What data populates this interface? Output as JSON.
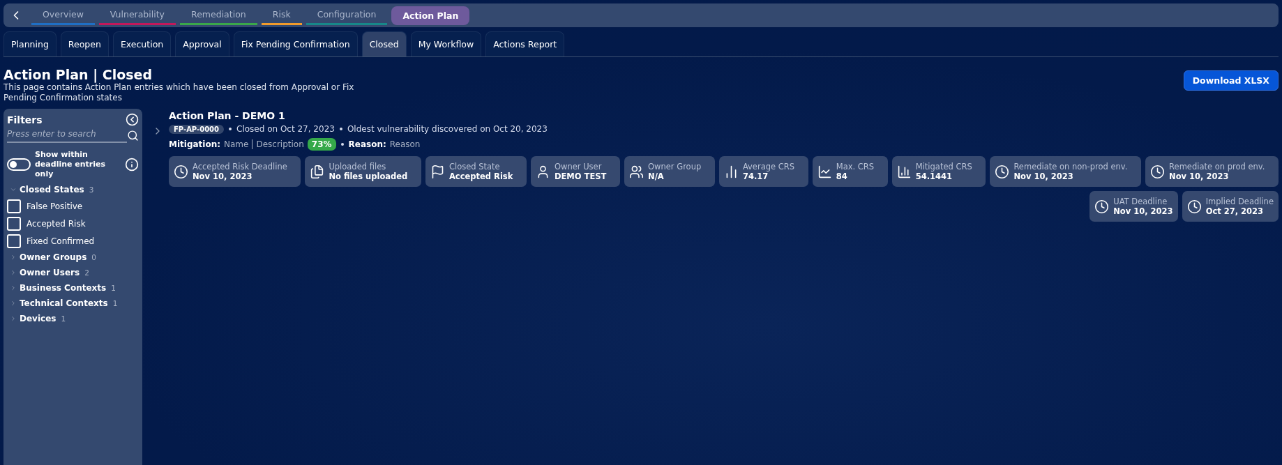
{
  "nav": {
    "tabs": [
      {
        "label": "Overview",
        "selected": false,
        "color": "#1f6fc5"
      },
      {
        "label": "Vulnerability",
        "selected": false,
        "color": "#c2185b"
      },
      {
        "label": "Remediation",
        "selected": false,
        "color": "#3aa84a"
      },
      {
        "label": "Risk",
        "selected": false,
        "color": "#f29b2b"
      },
      {
        "label": "Configuration",
        "selected": false,
        "color": "#17888a"
      },
      {
        "label": "Action Plan",
        "selected": true,
        "color": "#6e5a9c"
      }
    ]
  },
  "subtabs": [
    {
      "label": "Planning",
      "selected": false
    },
    {
      "label": "Reopen",
      "selected": false
    },
    {
      "label": "Execution",
      "selected": false
    },
    {
      "label": "Approval",
      "selected": false
    },
    {
      "label": "Fix Pending Confirmation",
      "selected": false
    },
    {
      "label": "Closed",
      "selected": true
    },
    {
      "label": "My Workflow",
      "selected": false
    },
    {
      "label": "Actions Report",
      "selected": false
    }
  ],
  "header": {
    "title": "Action Plan | Closed",
    "description": "This page contains Action Plan entries which have been closed from Approval or Fix Pending Confirmation states",
    "download_button": "Download XLSX"
  },
  "filters": {
    "title": "Filters",
    "search": {
      "placeholder": "Press enter to search"
    },
    "toggle": {
      "label": "Show within deadline entries only",
      "on": false
    },
    "groups": [
      {
        "label": "Closed States",
        "count": "3",
        "expanded": true,
        "options": [
          {
            "label": "False Positive",
            "checked": false
          },
          {
            "label": "Accepted Risk",
            "checked": false
          },
          {
            "label": "Fixed Confirmed",
            "checked": false
          }
        ]
      },
      {
        "label": "Owner Groups",
        "count": "0",
        "expanded": false
      },
      {
        "label": "Owner Users",
        "count": "2",
        "expanded": false
      },
      {
        "label": "Business Contexts",
        "count": "1",
        "expanded": false
      },
      {
        "label": "Technical Contexts",
        "count": "1",
        "expanded": false
      },
      {
        "label": "Devices",
        "count": "1",
        "expanded": false
      }
    ]
  },
  "entry": {
    "title": "Action Plan - DEMO 1",
    "expanded": false,
    "id": "FP-AP-0000",
    "closed": "Closed on Oct 27, 2023",
    "oldest": "Oldest vulnerability discovered on Oct 20, 2023",
    "mitigation_label": "Mitigation:",
    "mitigation_name": "Name",
    "mitigation_description": "Description",
    "percent": "73%",
    "reason_label": "Reason:",
    "reason": "Reason",
    "card_rows": [
      [
        {
          "kind": "clock",
          "label": "Accepted Risk Deadline",
          "value": "Nov 10, 2023"
        },
        {
          "kind": "files",
          "label": "Uploaded files",
          "value": "No files uploaded"
        },
        {
          "kind": "flag",
          "label": "Closed State",
          "value": "Accepted Risk"
        },
        {
          "kind": "user",
          "label": "Owner User",
          "value": "DEMO TEST"
        },
        {
          "kind": "users",
          "label": "Owner Group",
          "value": "N/A"
        },
        {
          "kind": "bars",
          "label": "Average CRS",
          "value": "74.17"
        },
        {
          "kind": "line",
          "label": "Max. CRS",
          "value": "84"
        },
        {
          "kind": "barchart",
          "label": "Mitigated CRS",
          "value": "54.1441"
        },
        {
          "kind": "clock",
          "label": "Remediate on non-prod env.",
          "value": "Nov 10, 2023"
        },
        {
          "kind": "clock",
          "label": "Remediate on prod env.",
          "value": "Nov 10, 2023"
        }
      ],
      [
        {
          "kind": "clock",
          "label": "UAT Deadline",
          "value": "Nov 10, 2023"
        },
        {
          "kind": "clock",
          "label": "Implied Deadline",
          "value": "Oct 27, 2023"
        }
      ]
    ]
  }
}
